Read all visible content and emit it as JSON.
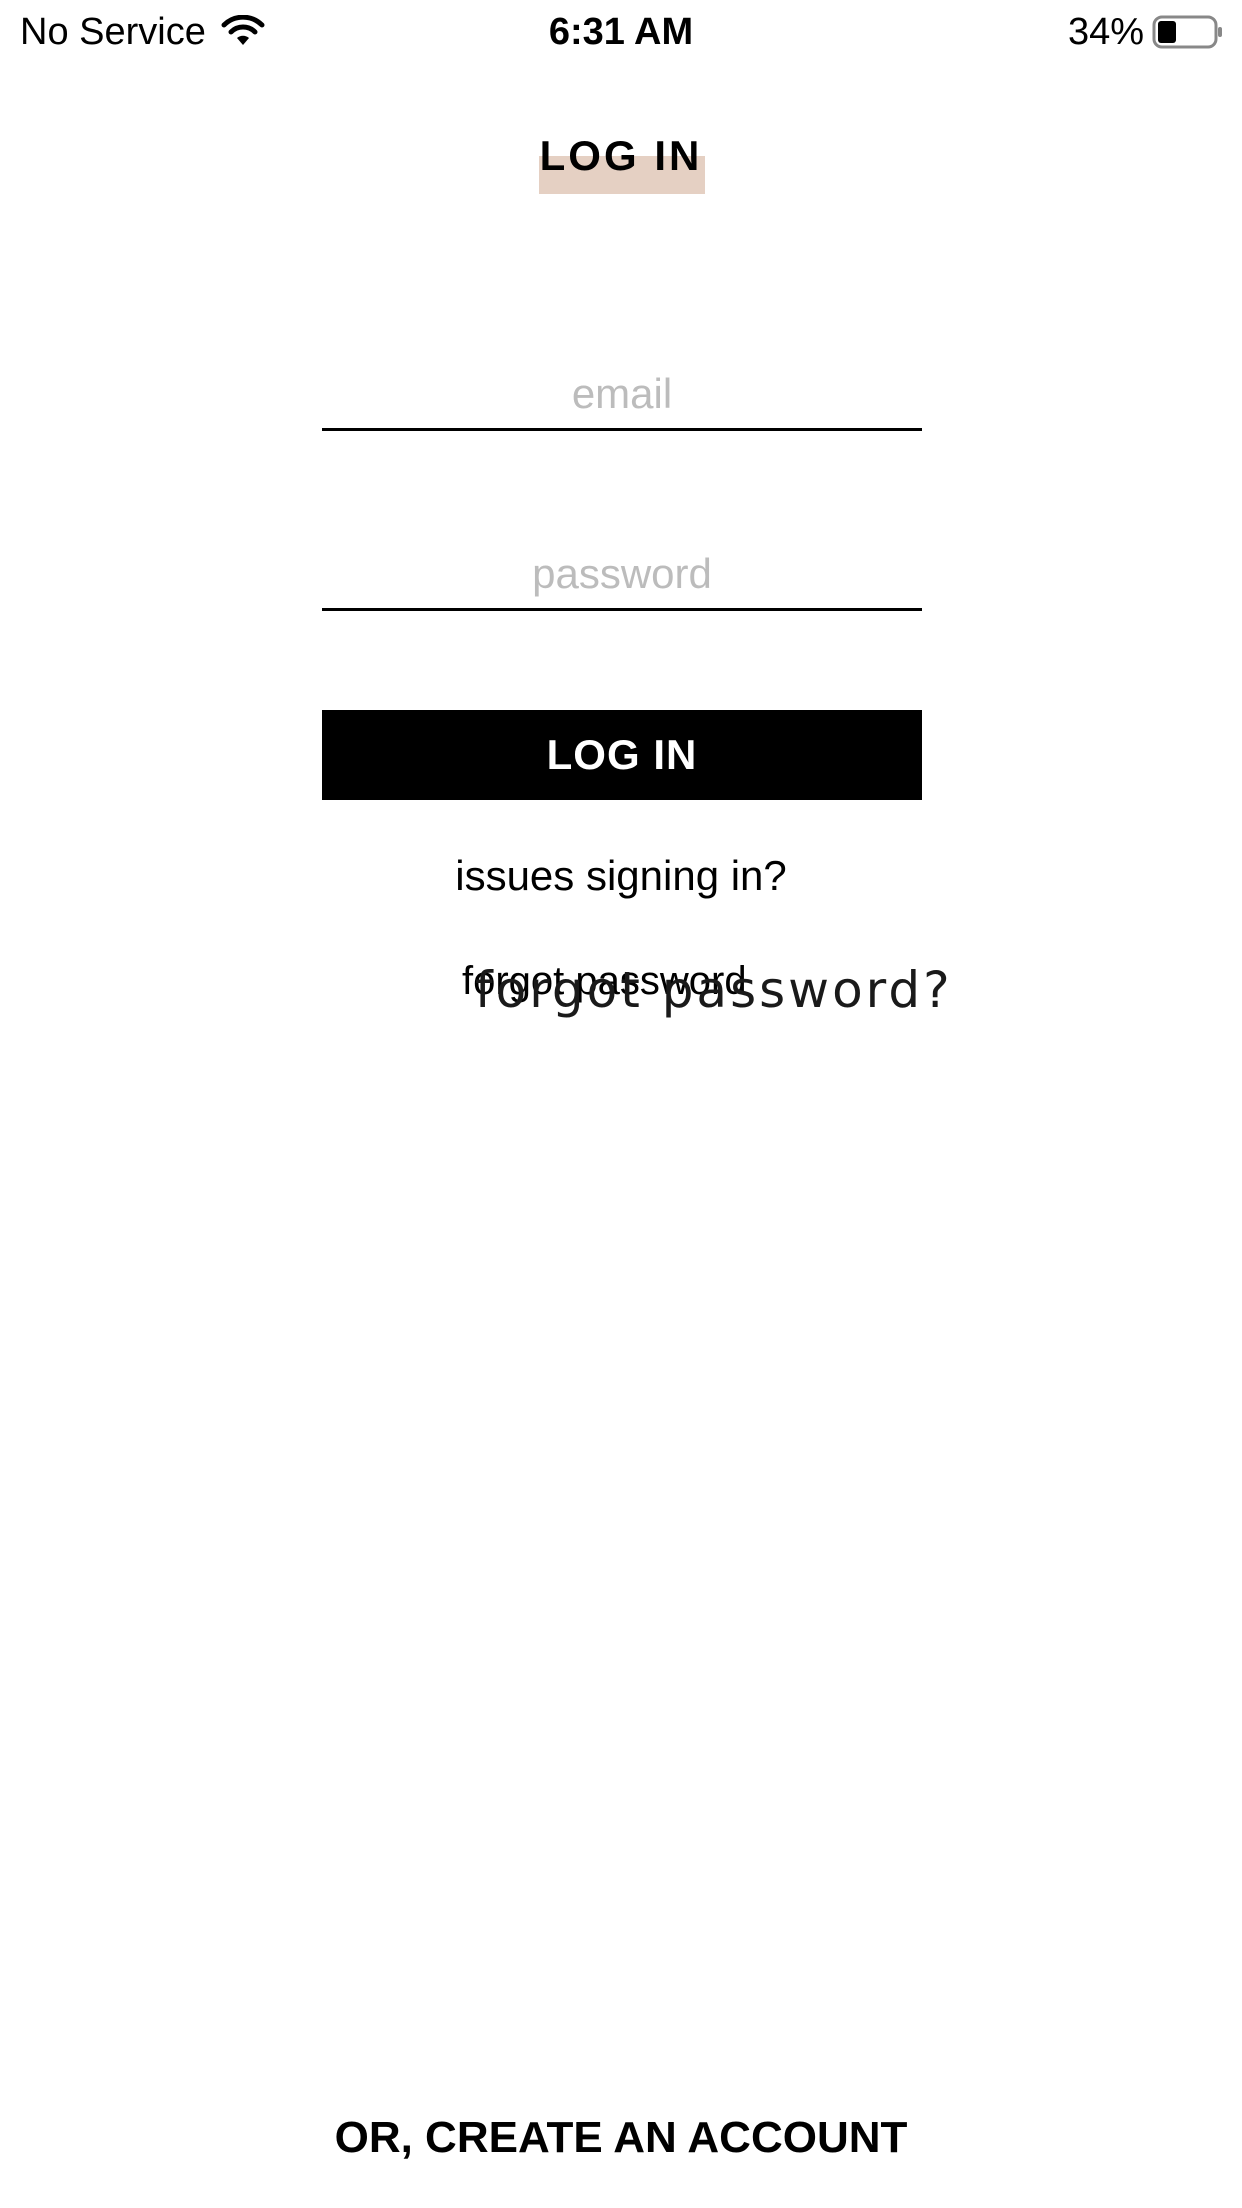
{
  "status_bar": {
    "carrier": "No Service",
    "time": "6:31 AM",
    "battery_percent": "34%",
    "battery_level": 0.34,
    "icons": [
      "wifi-icon",
      "battery-icon"
    ]
  },
  "header": {
    "title": "LOG IN",
    "highlight_color": "#e5d0c3"
  },
  "form": {
    "email_placeholder": "email",
    "email_value": "",
    "password_placeholder": "password",
    "password_value": "",
    "login_button_label": "LOG IN"
  },
  "links": {
    "issues_signing_in": "issues signing in?",
    "forgot_password_a": "forgot password",
    "forgot_password_b": "forgot password?"
  },
  "footer": {
    "create_account": "OR, CREATE AN ACCOUNT"
  }
}
